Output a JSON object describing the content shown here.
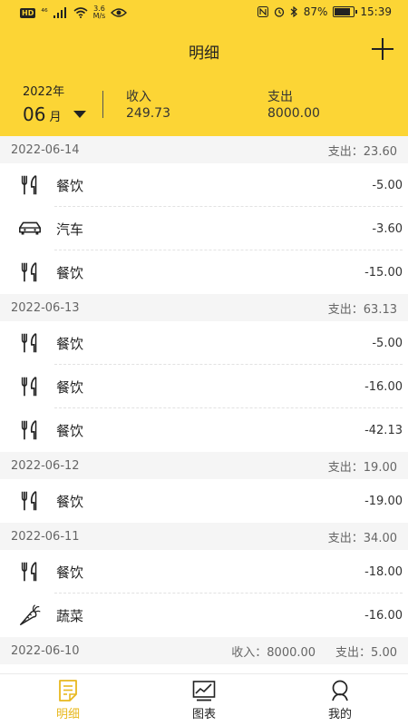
{
  "status": {
    "hd": "HD",
    "signal_tag": "⁴⁶",
    "speed_num": "3.6",
    "speed_unit": "M/s",
    "battery": "87%",
    "time": "15:39",
    "battery_level": 0.87
  },
  "header": {
    "title": "明细",
    "year": "2022年",
    "month": "06",
    "month_unit": "月",
    "income_label": "收入",
    "income_value": "249.73",
    "expense_label": "支出",
    "expense_value": "8000.00",
    "color": "#FCD535"
  },
  "days": [
    {
      "date": "2022-06-14",
      "income": "",
      "expense": "支出：23.60",
      "items": [
        {
          "icon": "utensils",
          "name": "餐饮",
          "amount": "-5.00"
        },
        {
          "icon": "car",
          "name": "汽车",
          "amount": "-3.60"
        },
        {
          "icon": "utensils",
          "name": "餐饮",
          "amount": "-15.00"
        }
      ]
    },
    {
      "date": "2022-06-13",
      "income": "",
      "expense": "支出：63.13",
      "items": [
        {
          "icon": "utensils",
          "name": "餐饮",
          "amount": "-5.00"
        },
        {
          "icon": "utensils",
          "name": "餐饮",
          "amount": "-16.00"
        },
        {
          "icon": "utensils",
          "name": "餐饮",
          "amount": "-42.13"
        }
      ]
    },
    {
      "date": "2022-06-12",
      "income": "",
      "expense": "支出：19.00",
      "items": [
        {
          "icon": "utensils",
          "name": "餐饮",
          "amount": "-19.00"
        }
      ]
    },
    {
      "date": "2022-06-11",
      "income": "",
      "expense": "支出：34.00",
      "items": [
        {
          "icon": "utensils",
          "name": "餐饮",
          "amount": "-18.00"
        },
        {
          "icon": "carrot",
          "name": "蔬菜",
          "amount": "-16.00"
        }
      ]
    },
    {
      "date": "2022-06-10",
      "income": "收入：8000.00",
      "expense": "支出：5.00",
      "items": []
    }
  ],
  "tabs": [
    {
      "icon": "notes",
      "label": "明细",
      "active": true
    },
    {
      "icon": "chart",
      "label": "图表",
      "active": false
    },
    {
      "icon": "user",
      "label": "我的",
      "active": false
    }
  ],
  "accent": "#E8B81E"
}
